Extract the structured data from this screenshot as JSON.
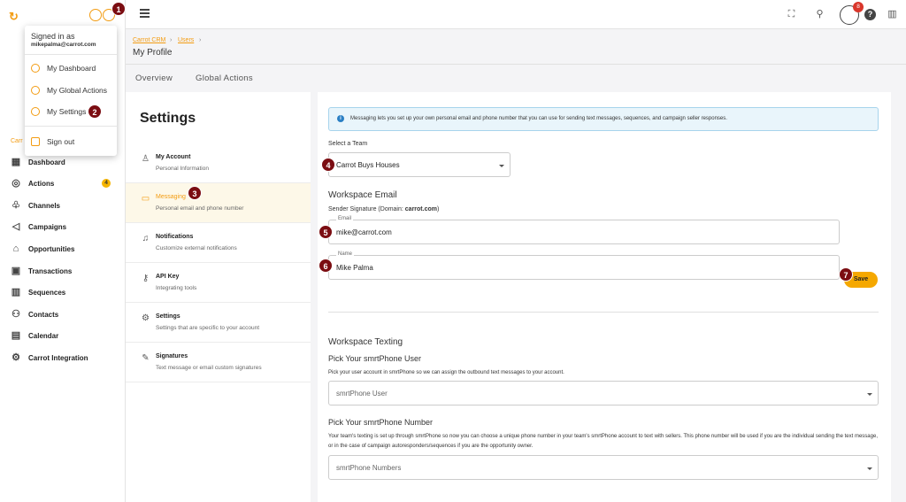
{
  "sidebar": {
    "logo": "↻",
    "cut_label": "Carr",
    "items": [
      {
        "label": "Dashboard",
        "icon": "dashboard-icon"
      },
      {
        "label": "Actions",
        "icon": "check-circle-icon",
        "badge": "4"
      },
      {
        "label": "Channels",
        "icon": "channels-icon"
      },
      {
        "label": "Campaigns",
        "icon": "megaphone-icon"
      },
      {
        "label": "Opportunities",
        "icon": "home-icon"
      },
      {
        "label": "Transactions",
        "icon": "transactions-icon"
      },
      {
        "label": "Sequences",
        "icon": "sequences-icon"
      },
      {
        "label": "Contacts",
        "icon": "contacts-icon"
      },
      {
        "label": "Calendar",
        "icon": "calendar-icon"
      },
      {
        "label": "Carrot Integration",
        "icon": "integration-icon"
      }
    ]
  },
  "popup": {
    "signed_in_as": "Signed in as",
    "email": "mikepalma@carrot.com",
    "items": [
      {
        "label": "My Dashboard"
      },
      {
        "label": "My Global Actions"
      },
      {
        "label": "My Settings"
      }
    ],
    "signout": "Sign out"
  },
  "markers": [
    "1",
    "2",
    "3",
    "4",
    "5",
    "6",
    "7"
  ],
  "topbar": {
    "notification_count": "8"
  },
  "header": {
    "breadcrumb": [
      "Carrot CRM",
      "Users"
    ],
    "title": "My Profile",
    "tabs": [
      "Overview",
      "Global Actions"
    ]
  },
  "settings": {
    "title": "Settings",
    "items": [
      {
        "name": "My Account",
        "desc": "Personal Information"
      },
      {
        "name": "Messaging",
        "desc": "Personal email and phone number"
      },
      {
        "name": "Notifications",
        "desc": "Customize external notifications"
      },
      {
        "name": "API Key",
        "desc": "Integrating tools"
      },
      {
        "name": "Settings",
        "desc": "Settings that are specific to your account"
      },
      {
        "name": "Signatures",
        "desc": "Text message or email custom signatures"
      }
    ]
  },
  "main": {
    "info_text": "Messaging lets you set up your own personal email and phone number that you can use for sending text messages, sequences, and campaign seller responses.",
    "select_team_label": "Select a Team",
    "team_value": "Carrot Buys Houses",
    "workspace_email_title": "Workspace Email",
    "sender_sig_prefix": "Sender Signature (Domain: ",
    "sender_sig_domain": "carrot.com",
    "sender_sig_suffix": ")",
    "email_label": "Email",
    "email_value": "mike@carrot.com",
    "name_label": "Name",
    "name_value": "Mike Palma",
    "save_label": "Save",
    "workspace_texting_title": "Workspace Texting",
    "pick_user_title": "Pick Your smrtPhone User",
    "pick_user_help": "Pick your user account in smrtPhone so we can assign the outbound text messages to your account.",
    "user_placeholder": "smrtPhone User",
    "pick_number_title": "Pick Your smrtPhone Number",
    "pick_number_help": "Your team's texting is set up through smrtPhone so now you can choose a unique phone number in your team's smrtPhone account to text with sellers. This phone number will be used if you are the individual sending the text message, or in the case of campaign autoresponders/sequences if you are the opportunity owner.",
    "number_placeholder": "smrtPhone Numbers"
  },
  "colors": {
    "accent": "#f39c12",
    "marker": "#7b0d12",
    "save": "#f5a800",
    "info_bg": "#e9f5fb"
  }
}
